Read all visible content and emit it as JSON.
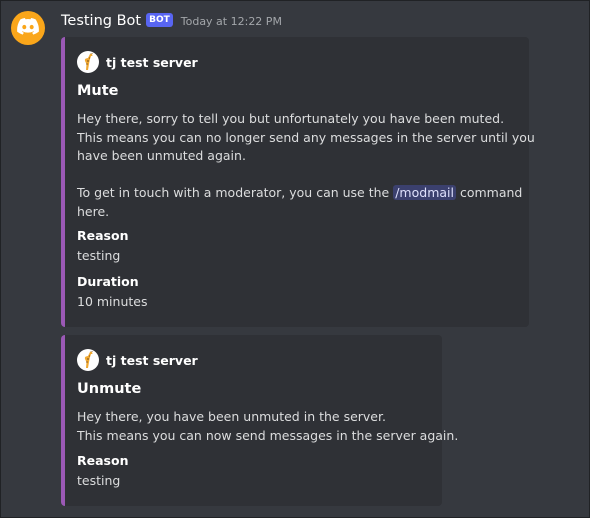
{
  "message": {
    "username": "Testing Bot",
    "bot_tag": "BOT",
    "timestamp": "Today at 12:22 PM",
    "avatar_icon": "discord-logo-icon",
    "accent_color": "#faa61a"
  },
  "embeds": [
    {
      "color": "#9b59b6",
      "author": "tj test server",
      "author_icon": "giraffe-icon",
      "title": "Mute",
      "description": {
        "line1": "Hey there, sorry to tell you but unfortunately you have been muted.",
        "line2": "This means you can no longer send any messages in the server until you",
        "line3": "have been unmuted again.",
        "line4_pre": "To get in touch with a moderator, you can use the ",
        "line4_cmd": "/modmail",
        "line4_post": " command",
        "line5": "here."
      },
      "fields": [
        {
          "name": "Reason",
          "value": "testing"
        },
        {
          "name": "Duration",
          "value": "10 minutes"
        }
      ]
    },
    {
      "color": "#9b59b6",
      "author": "tj test server",
      "author_icon": "giraffe-icon",
      "title": "Unmute",
      "description": {
        "line1": "Hey there, you have been unmuted in the server.",
        "line2": "This means you can now send messages in the server again."
      },
      "fields": [
        {
          "name": "Reason",
          "value": "testing"
        }
      ]
    }
  ]
}
